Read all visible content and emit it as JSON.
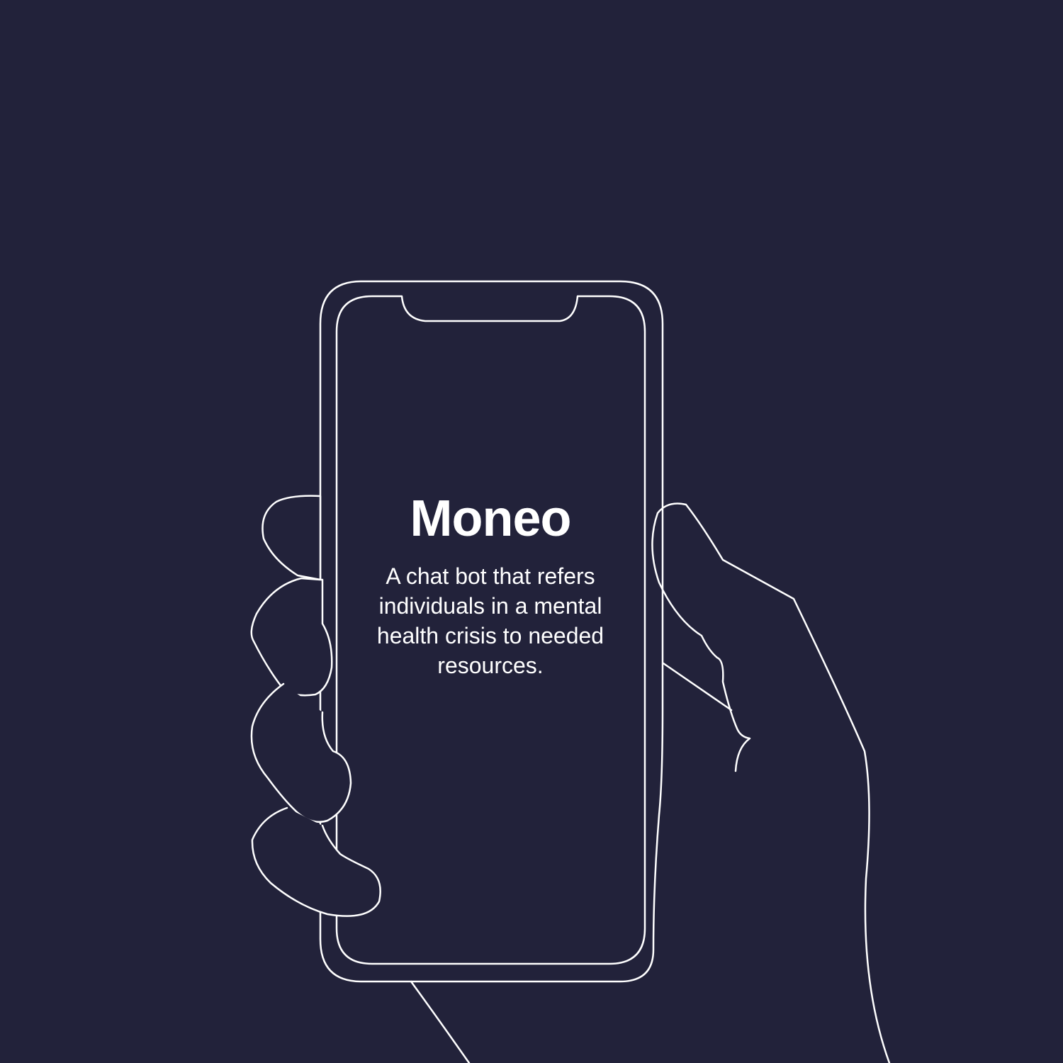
{
  "app": {
    "title": "Moneo",
    "tagline": "A chat bot that refers individuals in a mental health crisis to needed resources."
  },
  "colors": {
    "background": "#22223a",
    "line": "#ffffff",
    "text": "#ffffff"
  },
  "icons": {
    "illustration": "hand-holding-phone-line-art"
  }
}
